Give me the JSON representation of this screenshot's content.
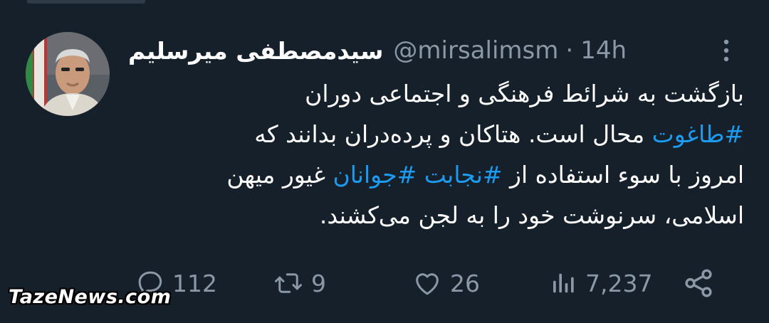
{
  "tweet": {
    "display_name": "سیدمصطفی میرسلیم",
    "handle": "@mirsalimsm",
    "separator": "·",
    "time": "14h",
    "text_segments": {
      "line1": "بازگشت به شرائط فرهنگی و اجتماعی دوران",
      "tag_taghut": "#طاغوت",
      "line2_rest": " محال است. هتاکان و پرده‌دران بدانند که",
      "line3_start": "امروز با سوء استفاده از ",
      "tag_nejabat": "#نجابت",
      "tag_javanan": "#جوانان",
      "line3_end": " غیور میهن",
      "line4": "اسلامی، سرنوشت خود را به لجن می‌کشند."
    }
  },
  "actions": {
    "replies": "112",
    "retweets": "9",
    "likes": "26",
    "views": "7,237"
  },
  "icons": {
    "reply": "reply-icon",
    "retweet": "retweet-icon",
    "like": "heart-icon",
    "views": "views-chart-icon",
    "share": "share-icon",
    "more": "more-vertical-icon"
  },
  "watermark": "TazeNews.com",
  "colors": {
    "background": "#15202b",
    "text": "#ffffff",
    "secondary": "#8b98a5",
    "hashtag": "#1d9bf0"
  }
}
